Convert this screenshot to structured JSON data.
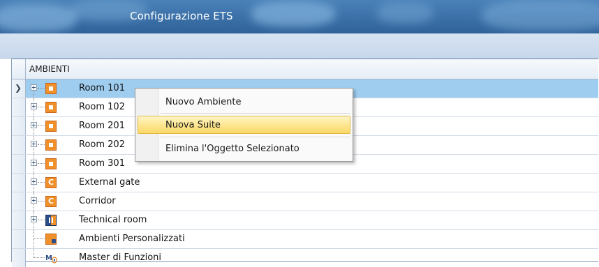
{
  "window": {
    "title": "Configurazione ETS"
  },
  "grid": {
    "column_header": "AMBIENTI",
    "rows": [
      {
        "label": "Room 101",
        "icon": "room-icon",
        "expandable": true,
        "selected": true
      },
      {
        "label": "Room 102",
        "icon": "room-icon",
        "expandable": true
      },
      {
        "label": "Room 201",
        "icon": "room-icon",
        "expandable": true
      },
      {
        "label": "Room 202",
        "icon": "room-icon",
        "expandable": true
      },
      {
        "label": "Room 301",
        "icon": "room-icon",
        "expandable": true
      },
      {
        "label": "External gate",
        "icon": "common-area-icon",
        "expandable": true,
        "icon_text": "C"
      },
      {
        "label": "Corridor",
        "icon": "common-area-icon",
        "expandable": true,
        "icon_text": "C"
      },
      {
        "label": "Technical room",
        "icon": "technical-room-icon",
        "expandable": true
      },
      {
        "label": "Ambienti Personalizzati",
        "icon": "custom-environment-icon",
        "expandable": false
      },
      {
        "label": "Master di Funzioni",
        "icon": "master-functions-icon",
        "expandable": false
      }
    ]
  },
  "context_menu": {
    "items": [
      {
        "label": "Nuovo Ambiente"
      },
      {
        "label": "Nuova Suite",
        "highlighted": true
      },
      {
        "label": "Elimina l'Oggetto Selezionato"
      }
    ]
  },
  "colors": {
    "title_bar": "#3d73aa",
    "selected_row": "#9ecdef",
    "menu_highlight": "#fde58d",
    "room_icon": "#f0902a"
  }
}
